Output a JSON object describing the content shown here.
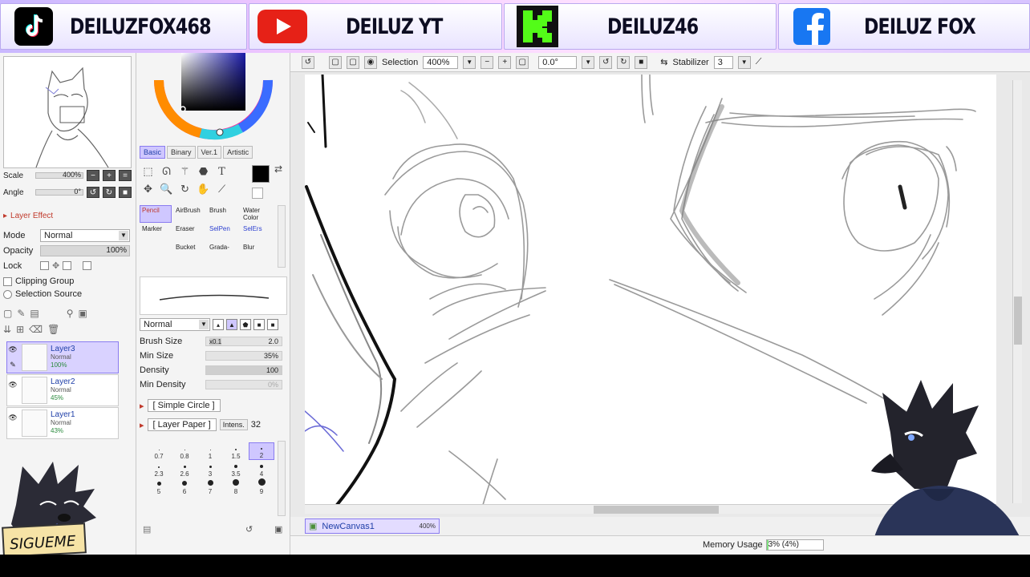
{
  "banner": {
    "items": [
      {
        "platform": "tiktok-icon",
        "name": "DEILUZFOX468"
      },
      {
        "platform": "youtube-icon",
        "name": "DEILUZ YT"
      },
      {
        "platform": "kick-icon",
        "name": "DEILUZ46"
      },
      {
        "platform": "facebook-icon",
        "name": "DEILUZ FOX"
      }
    ]
  },
  "navigator": {
    "scale_label": "Scale",
    "scale_value": "400%",
    "angle_label": "Angle",
    "angle_value": "0°"
  },
  "layer_panel": {
    "effect_label": "Layer Effect",
    "mode_label": "Mode",
    "mode_value": "Normal",
    "opacity_label": "Opacity",
    "opacity_value": "100%",
    "lock_label": "Lock",
    "clipping_label": "Clipping Group",
    "selection_source_label": "Selection Source",
    "layers": [
      {
        "name": "Layer3",
        "mode": "Normal",
        "opacity": "100%",
        "active": true
      },
      {
        "name": "Layer2",
        "mode": "Normal",
        "opacity": "45%",
        "active": false
      },
      {
        "name": "Layer1",
        "mode": "Normal",
        "opacity": "43%",
        "active": false
      }
    ]
  },
  "sign_text": "SIGUEME",
  "color_tabs": [
    "Basic",
    "Binary",
    "Ver.1",
    "Artistic"
  ],
  "brushes": [
    {
      "name": "Pencil",
      "active": true
    },
    {
      "name": "AirBrush",
      "active": false
    },
    {
      "name": "Brush",
      "active": false
    },
    {
      "name": "Water Color",
      "active": false
    },
    {
      "name": "Marker",
      "active": false
    },
    {
      "name": "Eraser",
      "active": false
    },
    {
      "name": "SelPen",
      "active": false,
      "blue": true
    },
    {
      "name": "SelErs",
      "active": false,
      "blue": true
    },
    {
      "name": "",
      "active": false
    },
    {
      "name": "Bucket",
      "active": false
    },
    {
      "name": "Grada-",
      "active": false
    },
    {
      "name": "Blur",
      "active": false
    }
  ],
  "brush_settings": {
    "blend_mode": "Normal",
    "brush_size_label": "Brush Size",
    "brush_size_mult": "x0.1",
    "brush_size_value": "2.0",
    "min_size_label": "Min Size",
    "min_size_value": "35%",
    "density_label": "Density",
    "density_value": "100",
    "min_density_label": "Min Density",
    "min_density_value": "0%",
    "shape_value": "[ Simple Circle ]",
    "texture_value": "[ Layer Paper ]",
    "intens_label": "Intens.",
    "intens_value": "32",
    "size_presets": [
      "0.7",
      "0.8",
      "1",
      "1.5",
      "2",
      "2.3",
      "2.6",
      "3",
      "3.5",
      "4",
      "5",
      "6",
      "7",
      "8",
      "9"
    ]
  },
  "toolbar": {
    "selection_label": "Selection",
    "zoom_value": "400%",
    "angle_value": "0.0°",
    "stabilizer_label": "Stabilizer",
    "stabilizer_value": "3"
  },
  "document": {
    "name": "NewCanvas1",
    "zoom": "400%"
  },
  "status": {
    "memory_label": "Memory Usage",
    "memory_value": "3% (4%)",
    "memory_fraction": 0.04
  },
  "colors": {
    "accent": "#cfc7ff",
    "accent_border": "#8a7cf0",
    "primary_color": "#000000"
  }
}
